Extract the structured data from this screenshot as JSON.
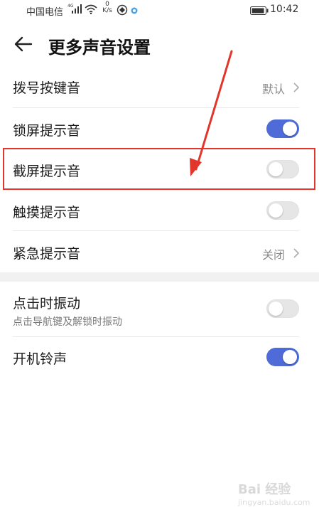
{
  "status_bar": {
    "carrier": "中国电信",
    "signal_type": "4G",
    "speed_value": "0",
    "speed_unit": "K/s",
    "time": "10:42"
  },
  "app_bar": {
    "title": "更多声音设置"
  },
  "settings": [
    {
      "label": "拨号按键音",
      "value": "默认"
    },
    {
      "label": "锁屏提示音",
      "toggle": "on"
    },
    {
      "label": "截屏提示音",
      "toggle": "off"
    },
    {
      "label": "触摸提示音",
      "toggle": "off"
    },
    {
      "label": "紧急提示音",
      "value": "关闭"
    },
    {
      "label": "点击时振动",
      "sublabel": "点击导航键及解锁时振动",
      "toggle": "off"
    },
    {
      "label": "开机铃声",
      "toggle": "on"
    }
  ],
  "colors": {
    "toggle_on": "#4e6bd8",
    "toggle_off": "#e6e6e6",
    "annotation_red": "#e2352b"
  },
  "watermark": {
    "brand": "Bai 经验",
    "url": "jingyan.baidu.com"
  }
}
